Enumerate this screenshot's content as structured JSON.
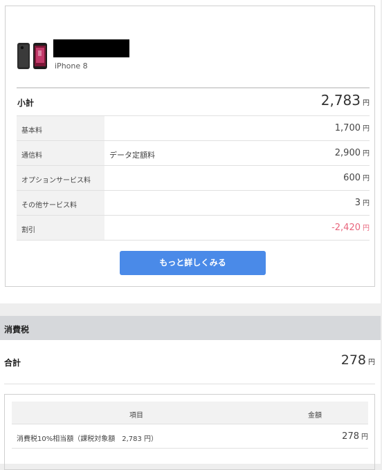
{
  "device": {
    "name": "iPhone 8"
  },
  "subtotal": {
    "label": "小計",
    "amount": "2,783",
    "unit": "円"
  },
  "fees": [
    {
      "label": "基本料",
      "sub": "",
      "amount": "1,700",
      "unit": "円"
    },
    {
      "label": "通信料",
      "sub": "データ定額料",
      "amount": "2,900",
      "unit": "円"
    },
    {
      "label": "オプションサービス料",
      "sub": "",
      "amount": "600",
      "unit": "円"
    },
    {
      "label": "その他サービス料",
      "sub": "",
      "amount": "3",
      "unit": "円"
    },
    {
      "label": "割引",
      "sub": "",
      "amount": "-2,420",
      "unit": "円"
    }
  ],
  "more_button": "もっと詳しくみる",
  "tax": {
    "header": "消費税",
    "total_label": "合計",
    "total_amount": "278",
    "total_unit": "円",
    "table": {
      "col_item": "項目",
      "col_amount": "金額",
      "rows": [
        {
          "item": "消費税10%相当額（課税対象額　2,783 円）",
          "amount": "278",
          "unit": "円"
        }
      ]
    }
  },
  "colors": {
    "accent": "#4a8ae8",
    "negative": "#e8657c",
    "header_bg": "#d6d8db"
  }
}
